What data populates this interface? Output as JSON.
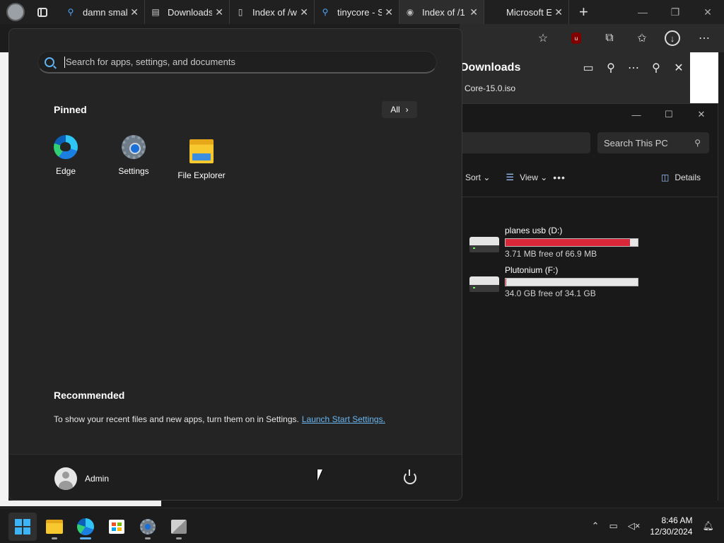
{
  "browser": {
    "tabs": [
      {
        "title": "damn small",
        "icon": "search-icon"
      },
      {
        "title": "Downloads",
        "icon": "page-icon"
      },
      {
        "title": "Index of /w",
        "icon": "doc-icon"
      },
      {
        "title": "tinycore - S",
        "icon": "search-icon"
      },
      {
        "title": "Index of /1",
        "icon": "globe-icon",
        "active": true
      },
      {
        "title": "Microsoft E",
        "icon": "microsoft-icon"
      }
    ]
  },
  "downloads": {
    "title": "Downloads",
    "file": "Core-15.0.iso"
  },
  "explorer": {
    "search_placeholder": "Search This PC",
    "sort_label": "Sort",
    "view_label": "View",
    "details_label": "Details",
    "drives": [
      {
        "name": "planes usb (D:)",
        "free": "3.71 MB free of 66.9 MB",
        "used_fraction": 0.94,
        "bar_color": "#da2639"
      },
      {
        "name": "Plutonium (F:)",
        "free": "34.0 GB free of 34.1 GB",
        "used_fraction": 0.003,
        "bar_color": "#da2639"
      }
    ]
  },
  "start_menu": {
    "search_placeholder": "Search for apps, settings, and documents",
    "pinned_title": "Pinned",
    "all_label": "All",
    "pinned_apps": [
      {
        "label": "Edge",
        "icon": "edge-icon"
      },
      {
        "label": "Settings",
        "icon": "settings-icon"
      },
      {
        "label": "File Explorer",
        "icon": "file-explorer-icon"
      }
    ],
    "recommended_title": "Recommended",
    "recommended_text": "To show your recent files and new apps, turn them on in Settings.",
    "recommended_link": "Launch Start Settings.",
    "user_name": "Admin"
  },
  "taskbar": {
    "time": "8:46 AM",
    "date": "12/30/2024"
  },
  "colors": {
    "accent": "#5fb2f2",
    "drive_bar_full": "#da2639"
  }
}
